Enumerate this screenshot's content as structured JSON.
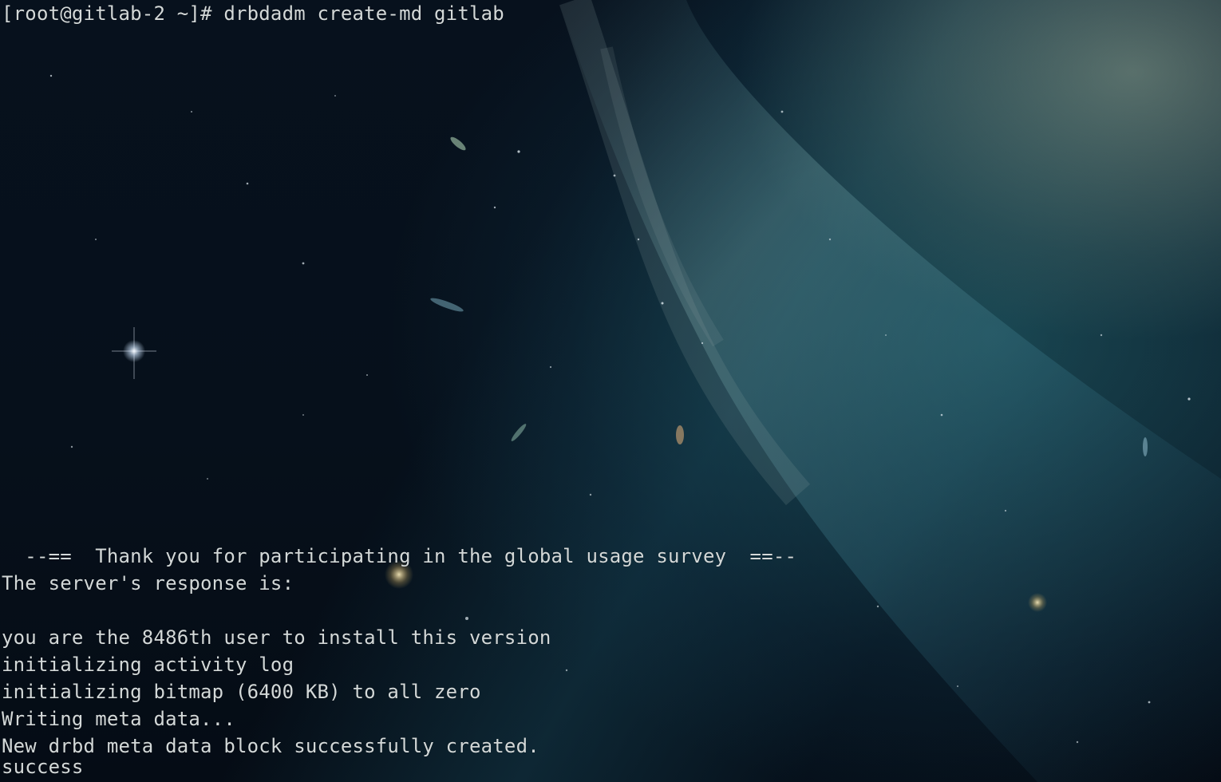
{
  "terminal": {
    "prompt_line": "[root@gitlab-2 ~]# drbdadm create-md gitlab",
    "output": [
      "  --==  Thank you for participating in the global usage survey  ==--",
      "The server's response is:",
      "",
      "you are the 8486th user to install this version",
      "initializing activity log",
      "initializing bitmap (6400 KB) to all zero",
      "Writing meta data...",
      "New drbd meta data block successfully created.",
      "success"
    ]
  },
  "theme": {
    "text_color": "#d3d8d8",
    "background": "#06101b",
    "accent_nebula": "#2a6f7c"
  }
}
